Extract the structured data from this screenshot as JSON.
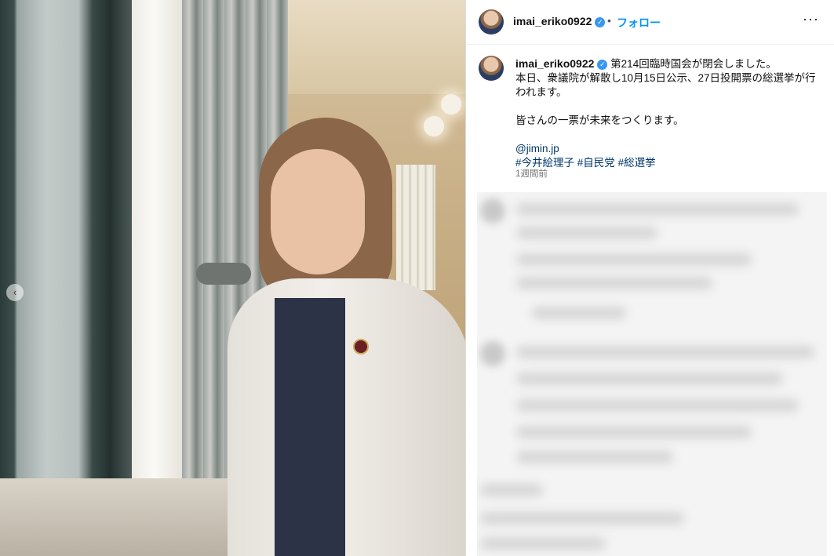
{
  "post": {
    "username": "imai_eriko0922",
    "verified_glyph": "✓",
    "dot": "•",
    "follow_label": "フォロー",
    "more_glyph": "···",
    "caption": {
      "lead": "第214回臨時国会が閉会しました。",
      "line2": "本日、衆議院が解散し10月15日公示、27日投開票の総選挙が行",
      "line3": "われます。",
      "line4": "皆さんの一票が未来をつくります。",
      "mention": "@jimin.jp",
      "hashtags": [
        "#今井絵理子",
        "#自民党",
        "#総選挙"
      ]
    },
    "timestamp": "1週間前"
  },
  "carousel": {
    "nav_glyph": "‹"
  },
  "icons": {
    "verified": "verified-badge-icon",
    "more": "more-options-icon",
    "carousel_prev": "chevron-left-icon"
  },
  "colors": {
    "link": "#0095f6",
    "hashtag": "#00376b",
    "verified": "#3897f0",
    "muted": "#737373"
  }
}
